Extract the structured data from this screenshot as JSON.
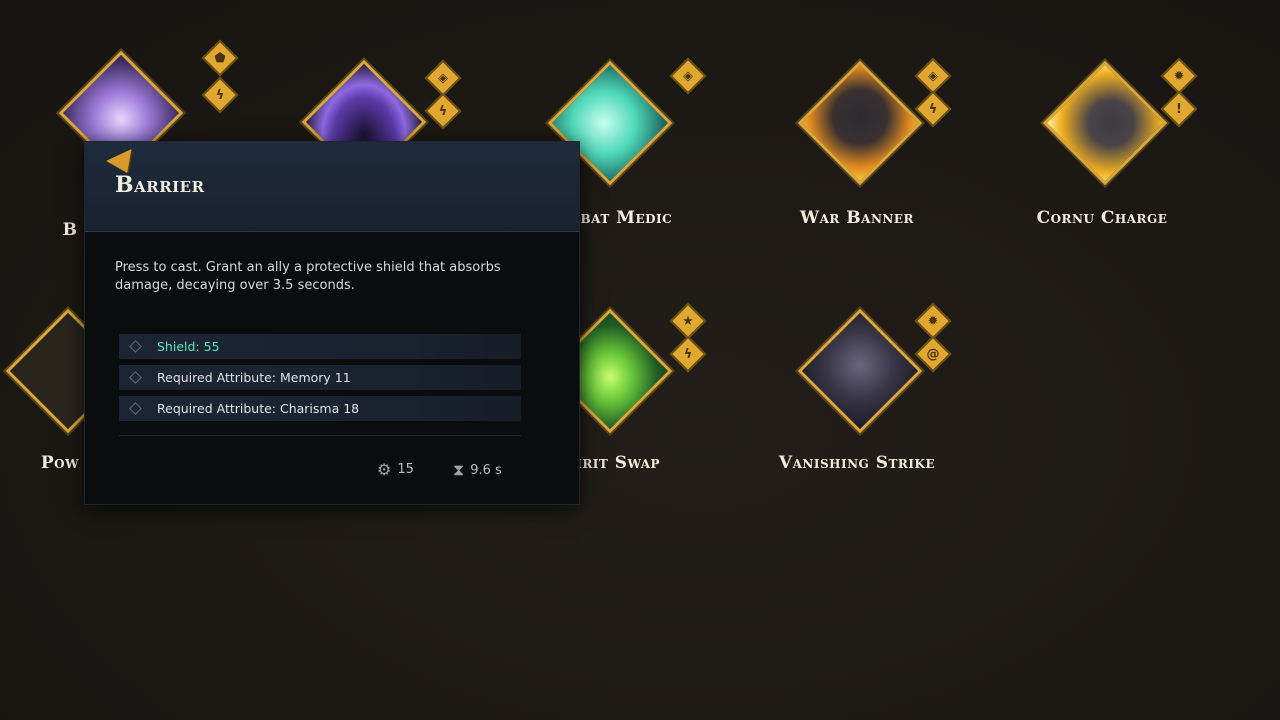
{
  "skills": [
    {
      "label": "B",
      "tags": [
        "shield-tag",
        "lightning-tag"
      ]
    },
    {
      "label": "",
      "tags": [
        "gem-tag",
        "lightning-tag"
      ]
    },
    {
      "label": "Combat Medic",
      "tags": [
        "gem-tag"
      ]
    },
    {
      "label": "War Banner",
      "tags": [
        "gem-tag",
        "lightning-tag"
      ]
    },
    {
      "label": "Cornu Charge",
      "tags": [
        "fire-tag",
        "exclaim-tag"
      ]
    },
    {
      "label": "Pow",
      "tags": []
    },
    {
      "label": "Spirit Swap",
      "tags": [
        "star-tag",
        "lightning-tag"
      ]
    },
    {
      "label": "Vanishing Strike",
      "tags": [
        "fire-tag",
        "swirl-tag"
      ]
    }
  ],
  "tooltip": {
    "title": "Barrier",
    "description": "Press to cast. Grant an ally a protective shield that absorbs damage, decaying over 3.5 seconds.",
    "stats": [
      {
        "text": "Shield: 55",
        "highlight": true
      },
      {
        "text": "Required Attribute: Memory 11",
        "highlight": false
      },
      {
        "text": "Required Attribute: Charisma 18",
        "highlight": false
      }
    ],
    "cost": "15",
    "cooldown": "9.6 s"
  },
  "colors": {
    "gold": "#d9a73a",
    "highlight": "#5fe3b4",
    "panel": "#1e2b3c"
  }
}
